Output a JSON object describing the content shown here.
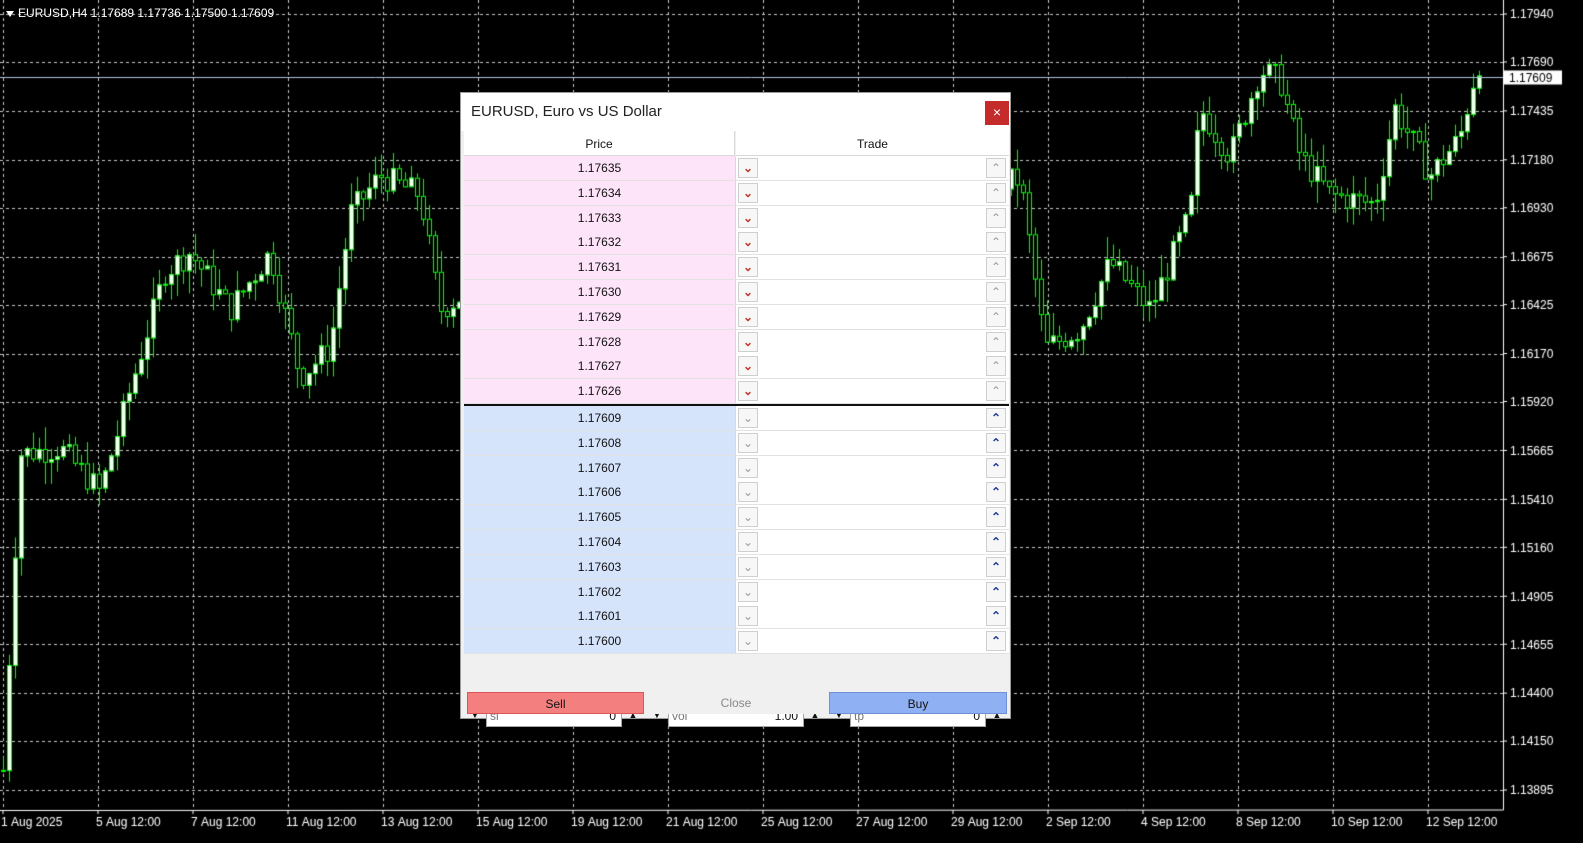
{
  "chart": {
    "header_text": "EURUSD,H4  1.17689 1.17736 1.17500 1.17609",
    "current_price_label": "1.17609",
    "price_axis": [
      "1.17940",
      "1.17690",
      "1.17435",
      "1.17180",
      "1.16930",
      "1.16675",
      "1.16425",
      "1.16170",
      "1.15920",
      "1.15665",
      "1.15410",
      "1.15160",
      "1.14905",
      "1.14655",
      "1.14400",
      "1.14150",
      "1.13895"
    ],
    "time_axis": [
      "1 Aug 2025",
      "5 Aug 12:00",
      "7 Aug 12:00",
      "11 Aug 12:00",
      "13 Aug 12:00",
      "15 Aug 12:00",
      "19 Aug 12:00",
      "21 Aug 12:00",
      "25 Aug 12:00",
      "27 Aug 12:00",
      "29 Aug 12:00",
      "2 Sep 12:00",
      "4 Sep 12:00",
      "8 Sep 12:00",
      "10 Sep 12:00",
      "12 Sep 12:00"
    ],
    "colors": {
      "background": "#000000",
      "grid": "#c8c8c8",
      "candle": "#00ff00",
      "bull_body": "#ffffff",
      "price_line": "#b0c4de"
    }
  },
  "dom": {
    "title": "EURUSD, Euro vs US Dollar",
    "close_symbol": "×",
    "headers": {
      "price": "Price",
      "trade": "Trade"
    },
    "ask_rows": [
      "1.17635",
      "1.17634",
      "1.17633",
      "1.17632",
      "1.17631",
      "1.17630",
      "1.17629",
      "1.17628",
      "1.17627",
      "1.17626"
    ],
    "bid_rows": [
      "1.17609",
      "1.17608",
      "1.17607",
      "1.17606",
      "1.17605",
      "1.17604",
      "1.17603",
      "1.17602",
      "1.17601",
      "1.17600"
    ],
    "arrow_down": "⌄",
    "arrow_up": "⌃",
    "sl": {
      "placeholder": "sl",
      "value": "0"
    },
    "vol": {
      "placeholder": "vol",
      "value": "1.00"
    },
    "tp": {
      "placeholder": "tp",
      "value": "0"
    },
    "spin_down": "▼",
    "spin_up": "▲",
    "buttons": {
      "sell": "Sell",
      "close": "Close",
      "buy": "Buy"
    },
    "colors": {
      "ask_bg": "#fde4f9",
      "bid_bg": "#d6e4fb",
      "sell": "#f47f7f",
      "buy": "#8fb0f2",
      "close_x": "#c42b2b"
    }
  }
}
